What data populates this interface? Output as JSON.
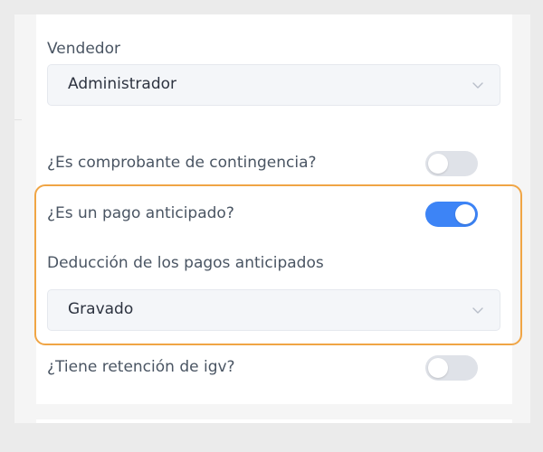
{
  "seller": {
    "label": "Vendedor",
    "value": "Administrador"
  },
  "contingency": {
    "label": "¿Es comprobante de contingencia?",
    "enabled": false
  },
  "advance_payment": {
    "label": "¿Es un pago anticipado?",
    "enabled": true
  },
  "deduction": {
    "label": "Deducción de los pagos anticipados",
    "value": "Gravado"
  },
  "igv_retention": {
    "label": "¿Tiene retención de igv?",
    "enabled": false
  },
  "colors": {
    "toggle_on": "#3d84f6",
    "toggle_off": "#dfe2e8",
    "highlight": "#f0a545"
  }
}
